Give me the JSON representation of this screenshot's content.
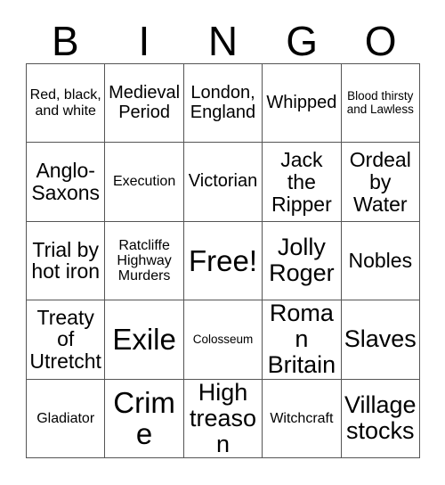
{
  "card": {
    "header_letters": [
      "B",
      "I",
      "N",
      "G",
      "O"
    ],
    "grid": {
      "columns": 5,
      "rows": 5,
      "free_space_label": "Free!",
      "free_space_position": {
        "row": 3,
        "column": 3
      }
    },
    "cells": [
      {
        "text": "Red, black, and white",
        "size": "s-sm"
      },
      {
        "text": "Medieval Period",
        "size": "s-md"
      },
      {
        "text": "London, England",
        "size": "s-md"
      },
      {
        "text": "Whipped",
        "size": "s-md"
      },
      {
        "text": "Blood thirsty and Lawless",
        "size": "s-xs"
      },
      {
        "text": "Anglo-Saxons",
        "size": "s-lg"
      },
      {
        "text": "Execution",
        "size": "s-sm"
      },
      {
        "text": "Victorian",
        "size": "s-md"
      },
      {
        "text": "Jack the Ripper",
        "size": "s-lg"
      },
      {
        "text": "Ordeal by Water",
        "size": "s-lg"
      },
      {
        "text": "Trial by hot iron",
        "size": "s-lg"
      },
      {
        "text": "Ratcliffe Highway Murders",
        "size": "s-sm"
      },
      {
        "text": "Free!",
        "size": "s-xxl"
      },
      {
        "text": "Jolly Roger",
        "size": "s-xl"
      },
      {
        "text": "Nobles",
        "size": "s-lg"
      },
      {
        "text": "Treaty of Utretcht",
        "size": "s-lg"
      },
      {
        "text": "Exile",
        "size": "s-xxl"
      },
      {
        "text": "Colosseum",
        "size": "s-xs"
      },
      {
        "text": "Roman Britain",
        "size": "s-xl"
      },
      {
        "text": "Slaves",
        "size": "s-xl"
      },
      {
        "text": "Gladiator",
        "size": "s-sm"
      },
      {
        "text": "Crime",
        "size": "s-xxl"
      },
      {
        "text": "High treason",
        "size": "s-xl"
      },
      {
        "text": "Witchcraft",
        "size": "s-sm"
      },
      {
        "text": "Village stocks",
        "size": "s-xl"
      }
    ]
  },
  "colors": {
    "background": "#ffffff",
    "text": "#000000",
    "border": "#555555"
  }
}
